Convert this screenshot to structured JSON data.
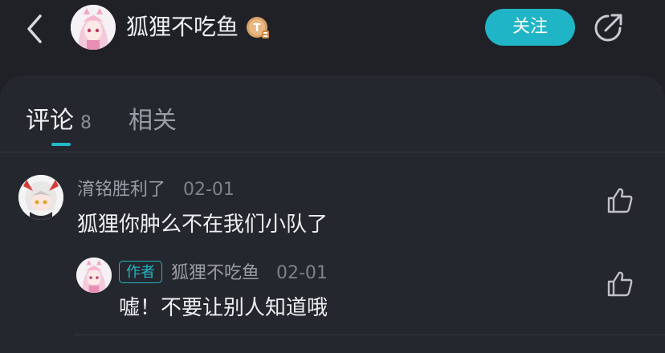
{
  "header": {
    "username": "狐狸不吃鱼",
    "follow_label": "关注",
    "badge_letter": "T"
  },
  "tabs": [
    {
      "label": "评论",
      "count": "8"
    },
    {
      "label": "相关"
    }
  ],
  "comments": [
    {
      "user": "淯铭胜利了",
      "date": "02-01",
      "text": "狐狸你肿么不在我们小队了"
    },
    {
      "user": "狐狸不吃鱼",
      "author_tag": "作者",
      "date": "02-01",
      "text": "嘘！不要让别人知道哦"
    }
  ],
  "colors": {
    "accent": "#1fb5c6",
    "background": "#1f2127",
    "panel": "#25272e"
  }
}
